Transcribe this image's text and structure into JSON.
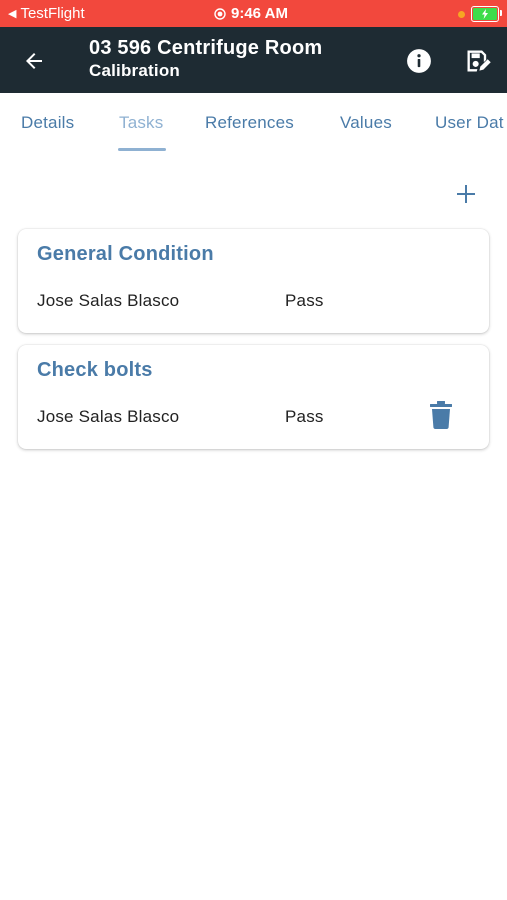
{
  "status_bar": {
    "carrier_arrow": "◀",
    "carrier": "TestFlight",
    "time": "9:46 AM"
  },
  "app_bar": {
    "title": "03 596 Centrifuge Room",
    "subtitle": "Calibration",
    "icons": [
      "arrow-back-icon",
      "info-icon",
      "save-edit-icon"
    ]
  },
  "tabs": [
    {
      "label": "Details",
      "active": false
    },
    {
      "label": "Tasks",
      "active": true
    },
    {
      "label": "References",
      "active": false
    },
    {
      "label": "Values",
      "active": false
    },
    {
      "label": "User Dat",
      "active": false
    }
  ],
  "tasks": [
    {
      "title": "General Condition",
      "user": "Jose Salas Blasco",
      "result": "Pass",
      "deletable": false
    },
    {
      "title": "Check bolts",
      "user": "Jose Salas Blasco",
      "result": "Pass",
      "deletable": true
    }
  ],
  "colors": {
    "status_bar": "#f2483d",
    "app_bar": "#1e2b33",
    "accent": "#4a7ba8",
    "accent_light": "#8fb1d2",
    "battery_fill": "#3ddc4a"
  }
}
